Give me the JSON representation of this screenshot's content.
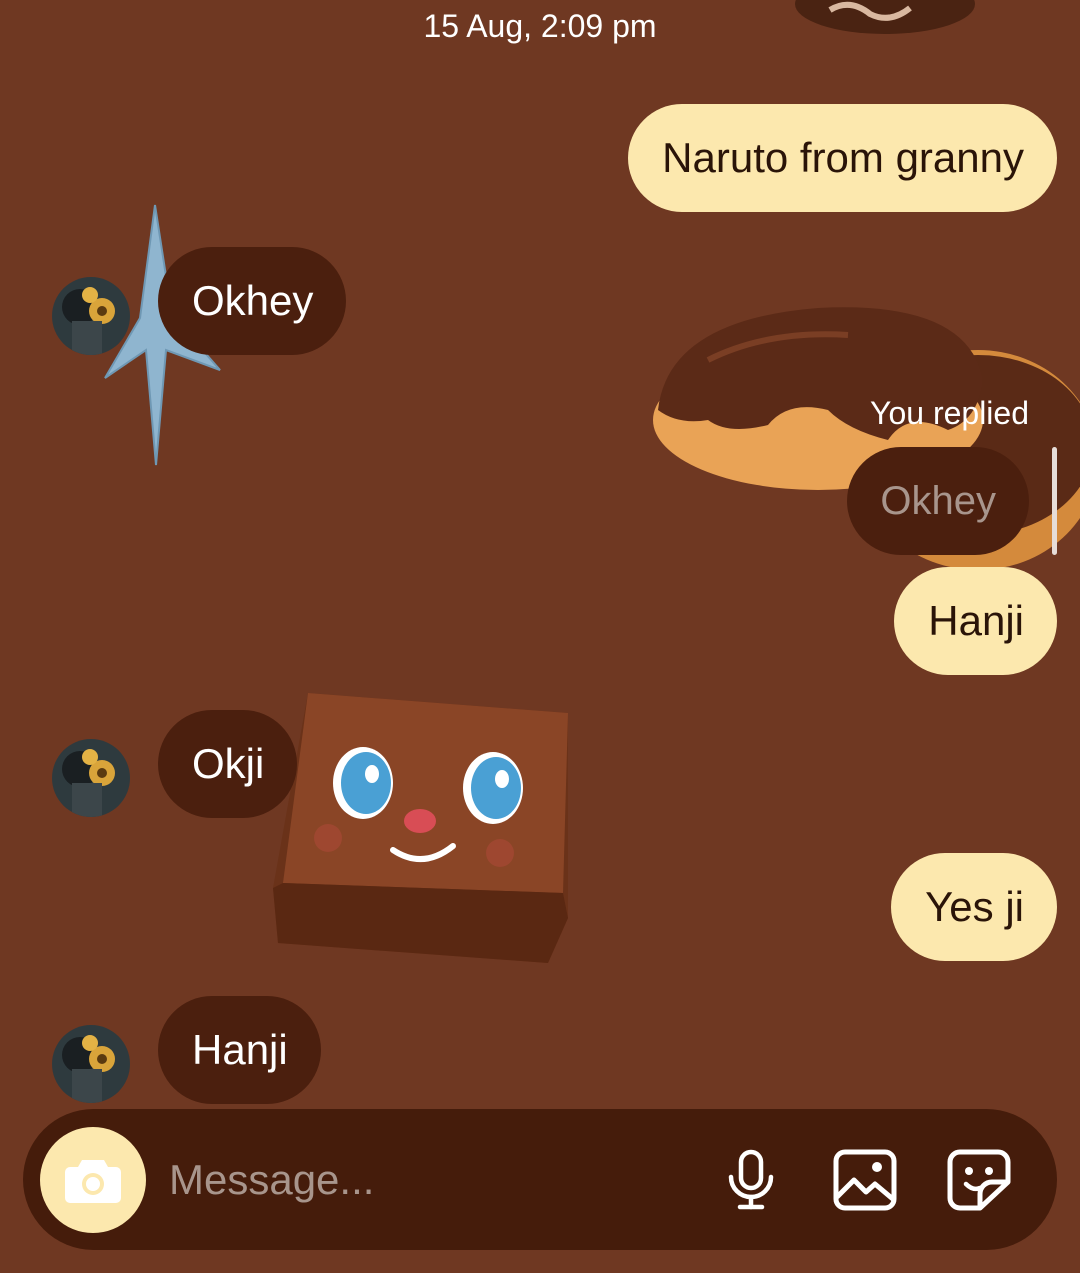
{
  "conversation": {
    "timestamp": "15 Aug, 2:09 pm",
    "messages": [
      {
        "direction": "sent",
        "text": "Naruto from granny"
      },
      {
        "direction": "received",
        "text": "Okhey"
      },
      {
        "direction": "sent",
        "reply_label": "You replied",
        "quoted_text": "Okhey",
        "text": "Hanji"
      },
      {
        "direction": "received",
        "text": "Okji"
      },
      {
        "direction": "sent",
        "text": "Yes ji"
      },
      {
        "direction": "received",
        "text": "Hanji"
      }
    ]
  },
  "composer": {
    "placeholder": "Message...",
    "icons": [
      "camera-icon",
      "microphone-icon",
      "gallery-icon",
      "sticker-icon"
    ]
  },
  "theme": {
    "background": "#6f3822",
    "sent_bubble": "#fce8ae",
    "received_bubble": "#4b1f0e",
    "composer_bar": "#451c0b"
  }
}
